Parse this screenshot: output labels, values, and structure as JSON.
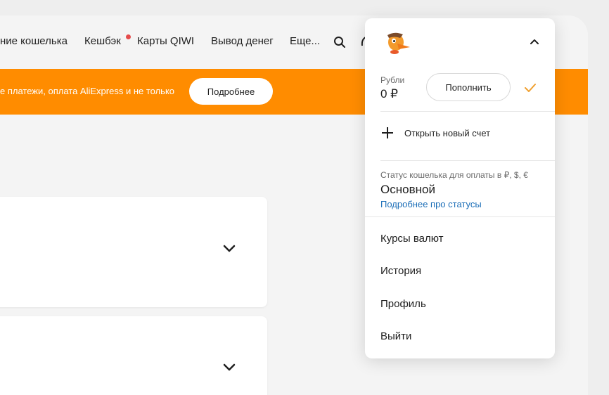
{
  "nav": {
    "items": [
      "ние кошелька",
      "Кешбэк",
      "Карты QIWI",
      "Вывод денег",
      "Еще..."
    ],
    "cashback_dot_color": "#e54b4b",
    "icons": [
      "search-icon",
      "cut-off-icon"
    ]
  },
  "banner": {
    "text": "е платежи, оплата AliExpress и не только",
    "button": "Подробнее",
    "color": "#ff8c00"
  },
  "cards": [
    {
      "icon": "chevron-down-icon"
    },
    {
      "icon": "chevron-down-icon"
    }
  ],
  "dropdown": {
    "avatar_icon": "duck-avatar-icon",
    "collapse_icon": "chevron-up-icon",
    "account": {
      "label": "Рубли",
      "balance": "0 ₽",
      "topup_button": "Пополнить",
      "selected_icon": "check-icon",
      "check_color": "#f0a030"
    },
    "open_account": {
      "icon": "plus-icon",
      "label": "Открыть новый счет"
    },
    "status": {
      "label": "Статус кошелька для оплаты в ₽, $, €",
      "value": "Основной",
      "link": "Подробнее про статусы",
      "link_color": "#1d6fb8"
    },
    "menu": [
      "Курсы валют",
      "История",
      "Профиль",
      "Выйти"
    ]
  }
}
